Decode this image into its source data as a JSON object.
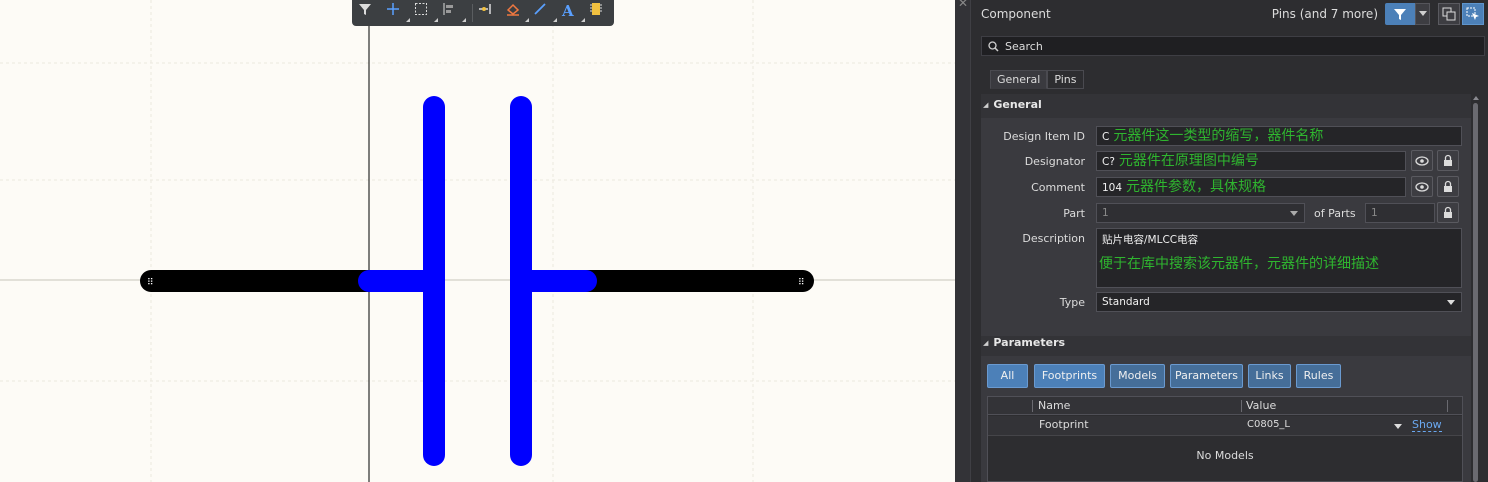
{
  "panel": {
    "title": "Component",
    "filter_label": "Pins (and 7 more)",
    "search_placeholder": "Search",
    "tabs": [
      "General",
      "Pins"
    ],
    "general": {
      "header": "General",
      "design_item_id": {
        "label": "Design Item ID",
        "value": "C",
        "note": "元器件这一类型的缩写，器件名称"
      },
      "designator": {
        "label": "Designator",
        "value": "C?",
        "note": "元器件在原理图中编号"
      },
      "comment": {
        "label": "Comment",
        "value": "104",
        "note": "元器件参数，具体规格"
      },
      "part": {
        "label": "Part",
        "value": "1",
        "of_parts_label": "of Parts",
        "of_parts_value": "1"
      },
      "description": {
        "label": "Description",
        "value": "贴片电容/MLCC电容",
        "note": "便于在库中搜索该元器件，元器件的详细描述"
      },
      "type": {
        "label": "Type",
        "value": "Standard"
      }
    },
    "parameters": {
      "header": "Parameters",
      "filters": [
        "All",
        "Footprints",
        "Models",
        "Parameters",
        "Links",
        "Rules"
      ],
      "columns": [
        "Name",
        "Value"
      ],
      "rows": [
        {
          "name": "Footprint",
          "value": "C0805_L",
          "action": "Show"
        }
      ],
      "empty_text": "No Models"
    }
  },
  "colors": {
    "canvas_bg": "#fdfbf6",
    "pin_body": "#000000",
    "symbol": "#0000ff",
    "annotation": "#2fb52f",
    "accent": "#4c80b8"
  }
}
